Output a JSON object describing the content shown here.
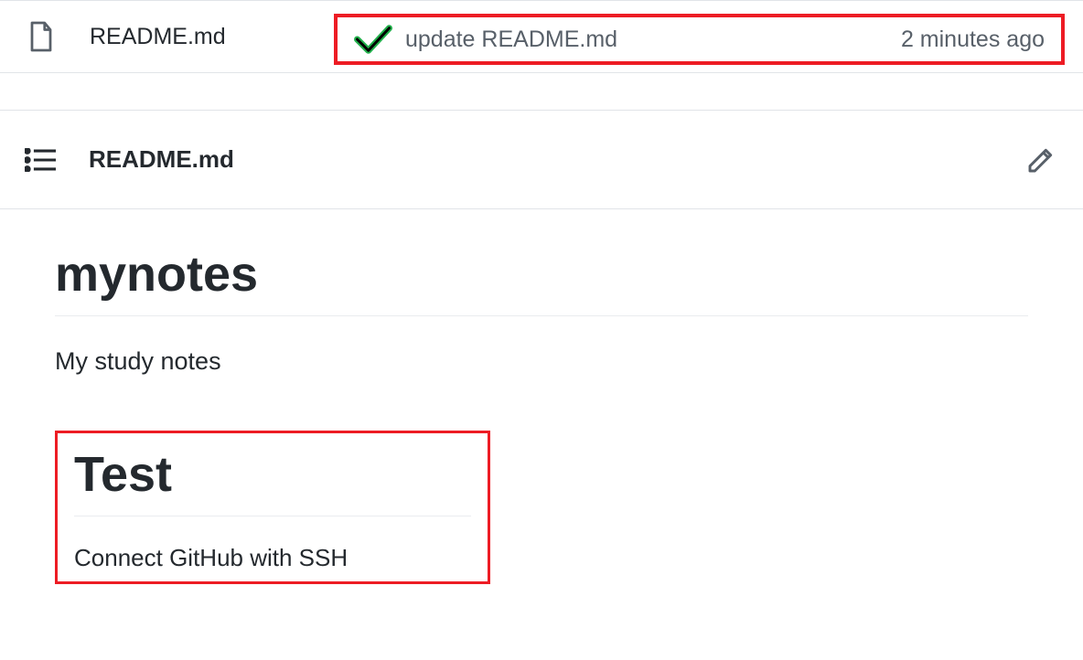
{
  "file_row": {
    "name": "README.md",
    "commit_message": "update README.md",
    "commit_time": "2 minutes ago"
  },
  "readme_header": {
    "title": "README.md"
  },
  "readme_body": {
    "h1_main": "mynotes",
    "p_main": "My study notes",
    "h1_test": "Test",
    "p_test": "Connect GitHub with SSH"
  }
}
